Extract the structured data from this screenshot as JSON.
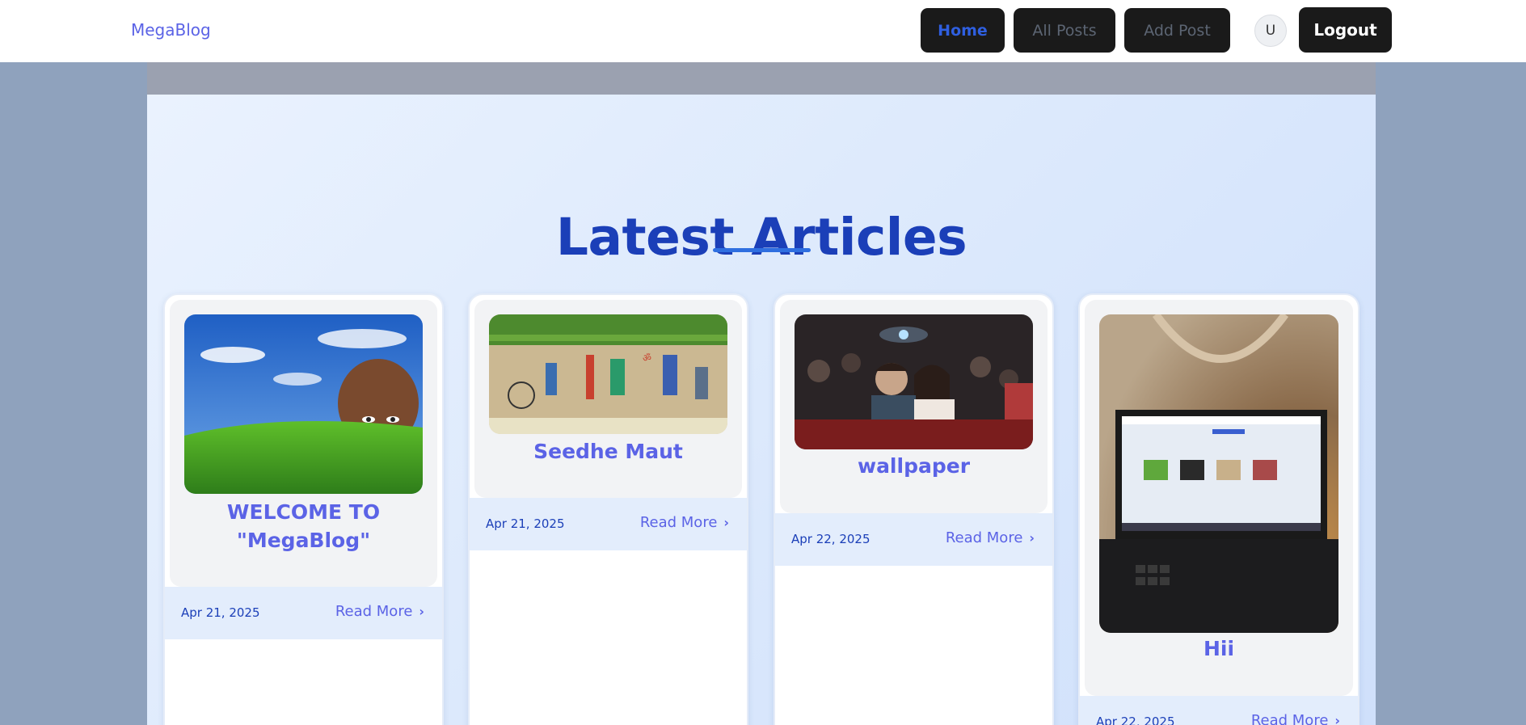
{
  "brand": "MegaBlog",
  "nav": {
    "home": "Home",
    "all_posts": "All Posts",
    "add_post": "Add Post",
    "avatar_initial": "U",
    "logout": "Logout"
  },
  "page": {
    "heading": "Latest Articles"
  },
  "posts": [
    {
      "title_line1": "WELCOME TO",
      "title_line2": "\"MegaBlog\"",
      "date": "Apr 21, 2025",
      "read_more": "Read More",
      "image": "bliss-wallpaper-bald-head"
    },
    {
      "title": "Seedhe Maut",
      "date": "Apr 21, 2025",
      "read_more": "Read More",
      "image": "street-mural"
    },
    {
      "title": "wallpaper",
      "date": "Apr 22, 2025",
      "read_more": "Read More",
      "image": "couple-in-cinema"
    },
    {
      "title": "Hii",
      "date": "Apr 22, 2025",
      "read_more": "Read More",
      "image": "laptop-showing-megablog"
    }
  ],
  "colors": {
    "accent": "#5b63e6",
    "heading": "#1b3fb8",
    "nav_button_bg": "#1a1a1a",
    "active_nav": "#2f5fe0",
    "page_bg": "#8fa2bd"
  }
}
